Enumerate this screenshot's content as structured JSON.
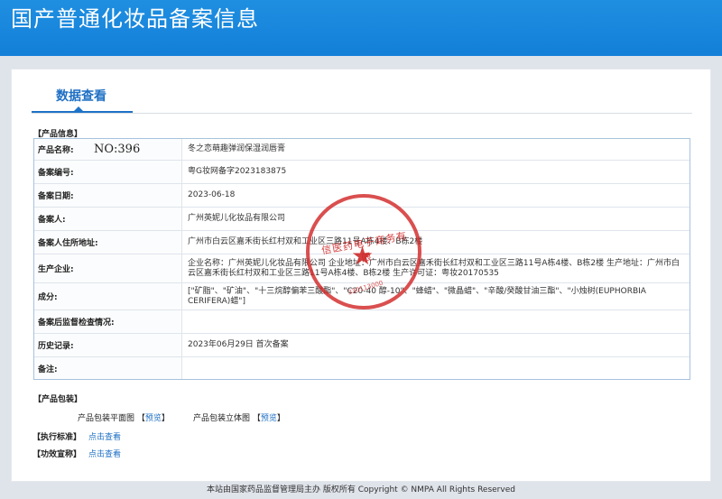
{
  "header": {
    "title": "国产普通化妆品备案信息"
  },
  "tabs": {
    "active": "数据查看"
  },
  "watermark": "NO:396",
  "stamp": {
    "text": "信医药电子商务有限",
    "code": "330113000"
  },
  "product_info": {
    "section_title": "【产品信息】",
    "rows": [
      {
        "label": "产品名称:",
        "value": "冬之恋萌趣弹润保湿润唇膏"
      },
      {
        "label": "备案编号:",
        "value": "粤G妆网备字2023183875"
      },
      {
        "label": "备案日期:",
        "value": "2023-06-18"
      },
      {
        "label": "备案人:",
        "value": "广州英妮儿化妆品有限公司"
      },
      {
        "label": "备案人住所地址:",
        "value": "广州市白云区嘉禾街长红村双和工业区三路11号A栋4楼、B栋2楼"
      },
      {
        "label": "生产企业:",
        "value": "企业名称：广州英妮儿化妆品有限公司 企业地址：广州市白云区嘉禾街长红村双和工业区三路11号A栋4楼、B栋2楼 生产地址：广州市白云区嘉禾街长红村双和工业区三路11号A栋4楼、B栋2楼 生产许可证：粤妆20170535"
      },
      {
        "label": "成分:",
        "value": "[\"矿脂\"、\"矿油\"、\"十三烷醇偏苯三酸酯\"、\"C20-40 醇-10\"、\"蜂蜡\"、\"微晶蜡\"、\"辛酸/癸酸甘油三酯\"、\"小烛树(EUPHORBIA CERIFERA)蜡\"]"
      },
      {
        "label": "备案后监督检查情况:",
        "value": ""
      },
      {
        "label": "历史记录:",
        "value": "2023年06月29日 首次备案"
      },
      {
        "label": "备注:",
        "value": ""
      }
    ]
  },
  "packaging": {
    "section_title": "【产品包装】",
    "flat_label": "产品包装平面图",
    "flat_link": "预览",
    "solid_label": "产品包装立体图",
    "solid_link": "预览"
  },
  "standard": {
    "label": "【执行标准】",
    "link": "点击查看"
  },
  "efficacy": {
    "label": "【功效宣称】",
    "link": "点击查看"
  },
  "footer": {
    "text": "本站由国家药品监督管理局主办 版权所有 Copyright © NMPA All Rights Reserved"
  }
}
